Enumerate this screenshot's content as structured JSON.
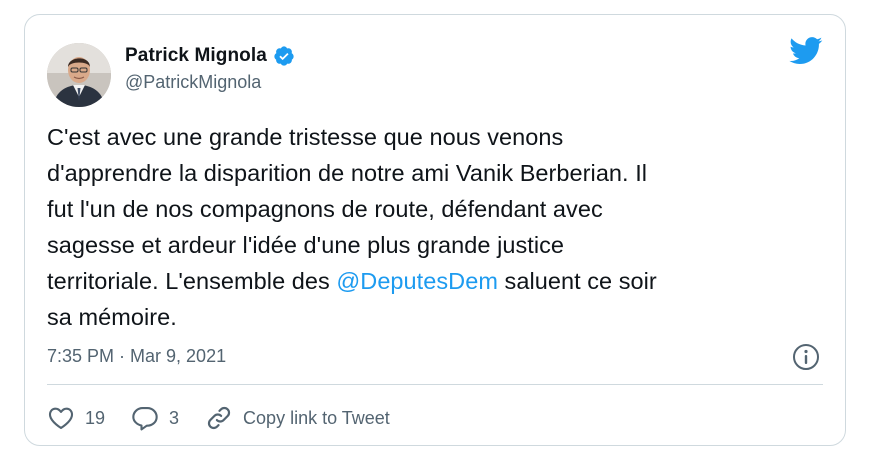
{
  "author": {
    "display_name": "Patrick Mignola",
    "handle": "@PatrickMignola",
    "verified": true
  },
  "tweet": {
    "text_before_mention": "C'est avec une grande tristesse que nous venons\nd'apprendre la disparition de notre ami Vanik Berberian. Il\nfut l'un de nos compagnons de route, défendant avec\nsagesse et ardeur l'idée d'une plus grande justice\nterritoriale. L'ensemble des ",
    "mention": "@DeputesDem",
    "text_after_mention": " saluent ce soir\nsa mémoire.",
    "timestamp": "7:35 PM · Mar 9, 2021"
  },
  "actions": {
    "likes_count": "19",
    "replies_count": "3",
    "copy_link_label": "Copy link to Tweet"
  },
  "icons": {
    "brand": "twitter-bird-icon",
    "verified": "verified-badge-icon",
    "info": "info-icon",
    "like": "heart-icon",
    "reply": "speech-bubble-icon",
    "copy": "link-icon"
  },
  "colors": {
    "accent": "#1d9bf0",
    "text": "#0f1419",
    "secondary_text": "#536471",
    "border": "#cfd9de"
  }
}
